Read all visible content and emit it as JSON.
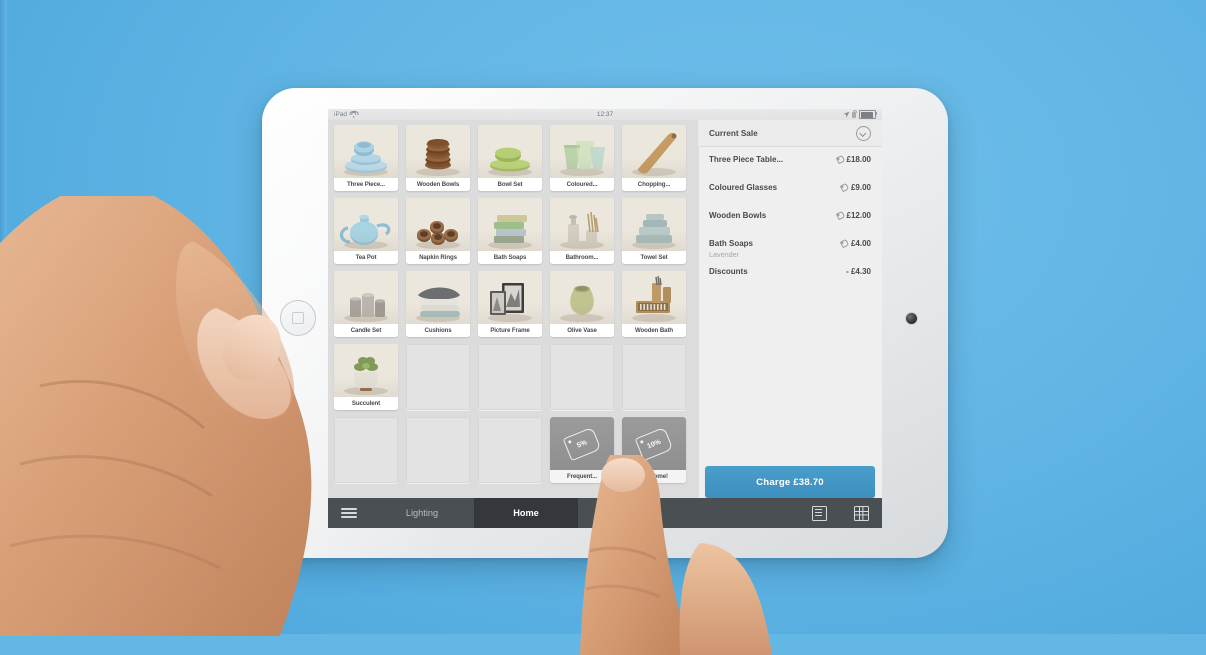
{
  "colors": {
    "background_blue": "#63b7e5",
    "charge_button_blue": "#3f96c4",
    "tabbar_dark": "#4a4f54",
    "tabbar_active": "#34383c",
    "screen_gray": "#dcdcdc",
    "sale_panel_gray": "#efefef"
  },
  "status_bar": {
    "device": "iPad",
    "wifi_icon": "wifi-icon",
    "clock": "12:37",
    "location_icon": "location-arrow-icon",
    "lock_icon": "rotation-lock-icon",
    "battery_icon": "battery-icon"
  },
  "grid": {
    "tiles": [
      {
        "label": "Three Piece...",
        "type": "product",
        "art": "plates-blue"
      },
      {
        "label": "Wooden Bowls",
        "type": "product",
        "art": "bowls-wood"
      },
      {
        "label": "Bowl Set",
        "type": "product",
        "art": "bowl-green"
      },
      {
        "label": "Coloured...",
        "type": "product",
        "art": "glasses"
      },
      {
        "label": "Chopping...",
        "type": "product",
        "art": "board"
      },
      {
        "label": "Tea Pot",
        "type": "product",
        "art": "teapot"
      },
      {
        "label": "Napkin Rings",
        "type": "product",
        "art": "rings"
      },
      {
        "label": "Bath Soaps",
        "type": "product",
        "art": "soaps"
      },
      {
        "label": "Bathroom...",
        "type": "product",
        "art": "dispenser"
      },
      {
        "label": "Towel Set",
        "type": "product",
        "art": "towels"
      },
      {
        "label": "Candle Set",
        "type": "product",
        "art": "candles"
      },
      {
        "label": "Cushions",
        "type": "product",
        "art": "cushions"
      },
      {
        "label": "Picture Frame",
        "type": "product",
        "art": "frames"
      },
      {
        "label": "Olive Vase",
        "type": "product",
        "art": "vase"
      },
      {
        "label": "Wooden Bath",
        "type": "product",
        "art": "woodenbath"
      },
      {
        "label": "Succulent",
        "type": "product",
        "art": "succulent"
      },
      {
        "label": "",
        "type": "empty",
        "art": ""
      },
      {
        "label": "",
        "type": "empty",
        "art": ""
      },
      {
        "label": "",
        "type": "empty",
        "art": ""
      },
      {
        "label": "",
        "type": "empty",
        "art": ""
      },
      {
        "label": "",
        "type": "empty",
        "art": ""
      },
      {
        "label": "",
        "type": "empty",
        "art": ""
      },
      {
        "label": "",
        "type": "empty",
        "art": ""
      },
      {
        "label": "Frequent...",
        "type": "discount",
        "badge": "5%"
      },
      {
        "label": "Welcome!",
        "type": "discount",
        "badge": "10%"
      }
    ]
  },
  "sale": {
    "title": "Current Sale",
    "collapse_icon": "chevron-down-circle-icon",
    "lines": [
      {
        "name": "Three Piece Table...",
        "sub": "",
        "amount": "£18.00",
        "tag": true
      },
      {
        "name": "Coloured Glasses",
        "sub": "",
        "amount": "£9.00",
        "tag": true
      },
      {
        "name": "Wooden Bowls",
        "sub": "",
        "amount": "£12.00",
        "tag": true
      },
      {
        "name": "Bath Soaps",
        "sub": "Lavender",
        "amount": "£4.00",
        "tag": true
      },
      {
        "name": "Discounts",
        "sub": "",
        "amount": "- £4.30",
        "tag": false
      }
    ],
    "charge_label": "Charge £38.70"
  },
  "tabbar": {
    "menu_icon": "hamburger-menu-icon",
    "tabs": [
      {
        "label": "Lighting",
        "active": false
      },
      {
        "label": "Home",
        "active": true
      },
      {
        "label": "",
        "active": false
      }
    ],
    "list_icon": "list-view-icon",
    "grid_icon": "grid-view-icon"
  }
}
